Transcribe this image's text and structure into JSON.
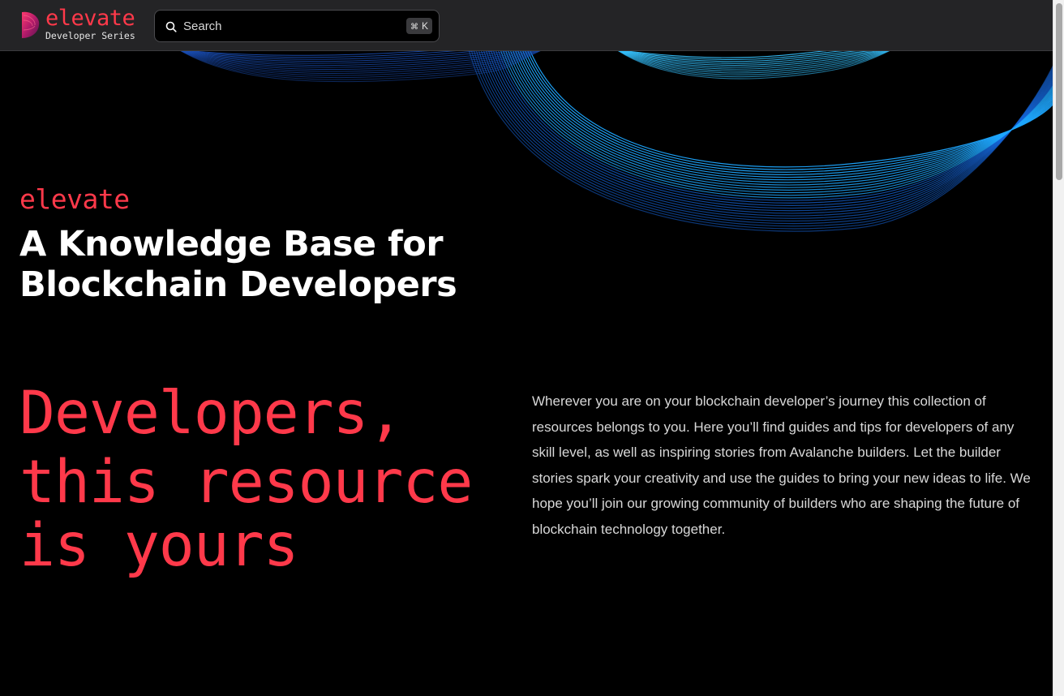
{
  "colors": {
    "accent": "#ff394a",
    "header_bg": "#242426",
    "page_bg": "#000000",
    "wave_blue": "#1ea7ff"
  },
  "header": {
    "logo": {
      "wordmark": "elevate",
      "subtitle": "Developer Series",
      "icon": "logo-mark-icon"
    },
    "search": {
      "icon": "search-icon",
      "placeholder": "Search",
      "shortcut_symbol": "⌘",
      "shortcut_key": "K"
    }
  },
  "hero": {
    "brand": "elevate",
    "title_line1": "A Knowledge Base for",
    "title_line2": "Blockchain Developers"
  },
  "tagline": {
    "line1": "Developers,",
    "line2": "this resource",
    "line3": "is yours"
  },
  "intro": {
    "text": "Wherever you are on your blockchain developer’s journey this collection of resources belongs to you. Here you’ll find guides and tips for developers of any skill level, as well as inspiring stories from Avalanche builders. Let the builder stories spark your creativity and use the guides to bring your new ideas to life. We hope you’ll join our growing community of builders who are shaping the future of blockchain technology together."
  }
}
